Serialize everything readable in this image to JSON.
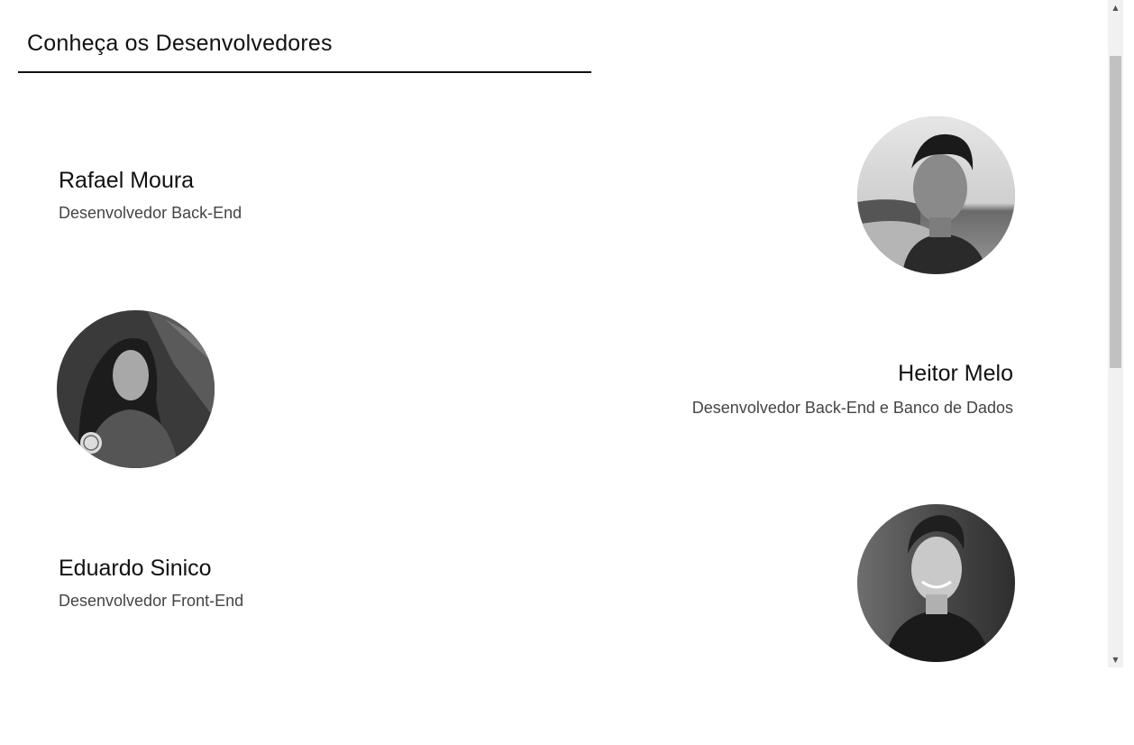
{
  "section": {
    "title": "Conheça os Desenvolvedores"
  },
  "developers": [
    {
      "name": "Rafael Moura",
      "role": "Desenvolvedor Back-End"
    },
    {
      "name": "Heitor Melo",
      "role": "Desenvolvedor Back-End e Banco de Dados"
    },
    {
      "name": "Eduardo Sinico",
      "role": "Desenvolvedor Front-End"
    }
  ],
  "scrollbar": {
    "up_icon": "chevron-up-icon",
    "down_icon": "chevron-down-icon"
  },
  "colors": {
    "text": "#111111",
    "subtext": "#444444",
    "background": "#ffffff"
  }
}
